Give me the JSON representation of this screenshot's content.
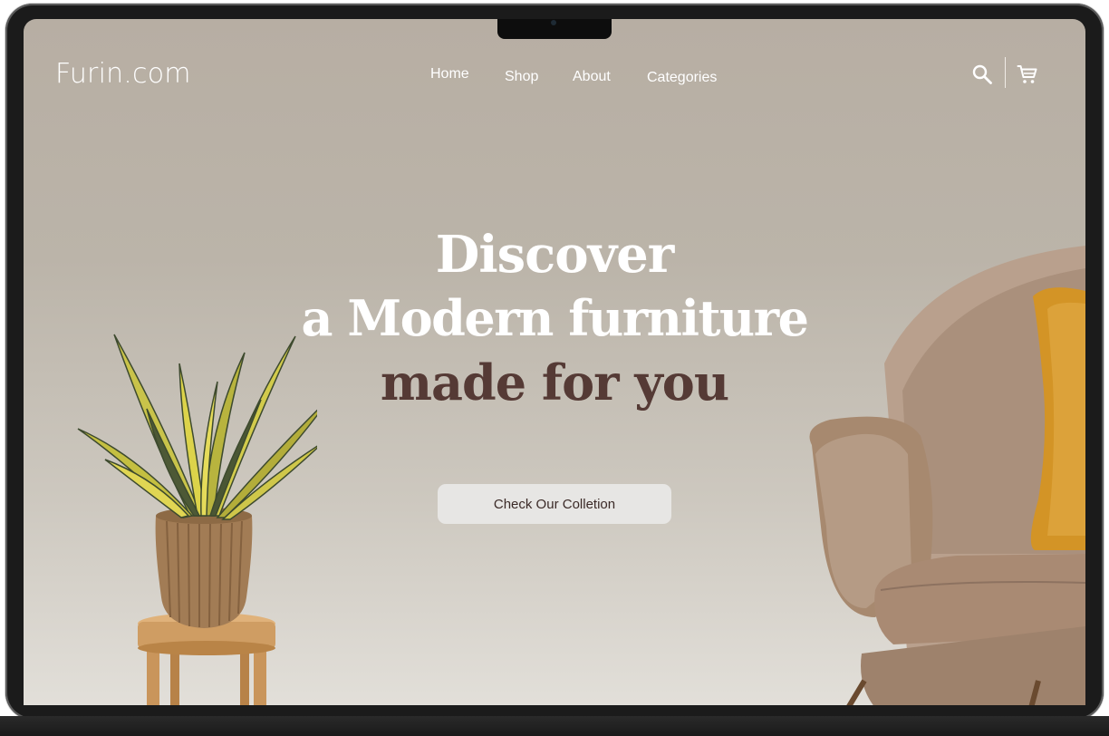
{
  "site": {
    "logo": "Furin.com"
  },
  "nav": {
    "items": [
      "Home",
      "Shop",
      "About",
      "Categories"
    ]
  },
  "header_icons": {
    "search": "search-icon",
    "cart": "cart-icon"
  },
  "hero": {
    "line1": "Discover",
    "line2": "a Modern furniture",
    "line3": "made for you",
    "cta_label": "Check Our Colletion"
  },
  "colors": {
    "background_top": "#b7aea3",
    "background_bottom": "#e2dfd9",
    "accent_text": "#553a35",
    "button_bg": "#e7e6e4",
    "pillow": "#d39426",
    "chair": "#a88b77"
  }
}
